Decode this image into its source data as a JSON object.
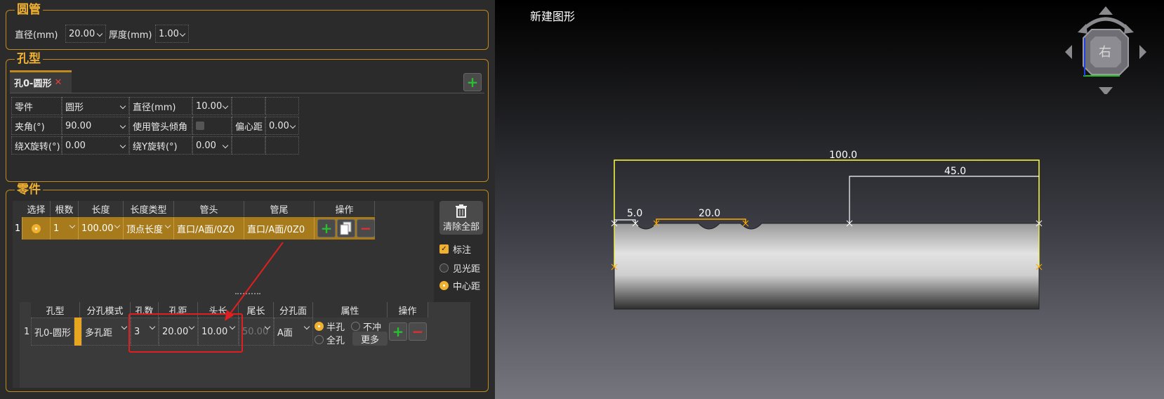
{
  "round_tube": {
    "title": "圆管",
    "diameter_label": "直径(mm)",
    "diameter_value": "20.00",
    "thickness_label": "厚度(mm)",
    "thickness_value": "1.00"
  },
  "hole_type": {
    "title": "孔型",
    "tab_label": "孔0-圆形",
    "tab_close": "✕",
    "add": "+",
    "props": {
      "part_label": "零件",
      "part_value": "圆形",
      "diameter_label": "直径(mm)",
      "diameter_value": "10.00",
      "angle_label": "夹角(°)",
      "angle_value": "90.00",
      "use_head_angle_label": "使用管头倾角",
      "eccentric_label": "偏心距",
      "eccentric_value": "0.00",
      "rot_x_label": "绕X旋转(°)",
      "rot_x_value": "0.00",
      "rot_y_label": "绕Y旋转(°)",
      "rot_y_value": "0.00"
    }
  },
  "parts": {
    "title": "零件",
    "headers": [
      "选择",
      "根数",
      "长度",
      "长度类型",
      "管头",
      "管尾",
      "操作"
    ],
    "row": {
      "index": "1",
      "count": "1",
      "length": "100.00",
      "length_type": "顶点长度",
      "head": "直口/A面/0Z0",
      "tail": "直口/A面/0Z0"
    },
    "clear_all": "清除全部",
    "annotate_label": "标注",
    "visible_distance": "见光距",
    "center_distance": "中心距",
    "sub_headers": [
      "孔型",
      "分孔模式",
      "孔数",
      "孔距",
      "头长",
      "尾长",
      "分孔面",
      "属性",
      "操作"
    ],
    "sub_row": {
      "index": "1",
      "hole_type": "孔0-圆形",
      "mode": "多孔距",
      "count": "3",
      "spacing": "20.00",
      "head_len": "10.00",
      "tail_len": "50.00",
      "face": "A面",
      "half": "半孔",
      "no_punch": "不冲",
      "full": "全孔",
      "more": "更多"
    }
  },
  "viewport": {
    "title": "新建图形",
    "view_face": "右",
    "dims": {
      "total": "100.0",
      "right": "45.0",
      "first": "5.0",
      "spacing": "20.0"
    }
  }
}
